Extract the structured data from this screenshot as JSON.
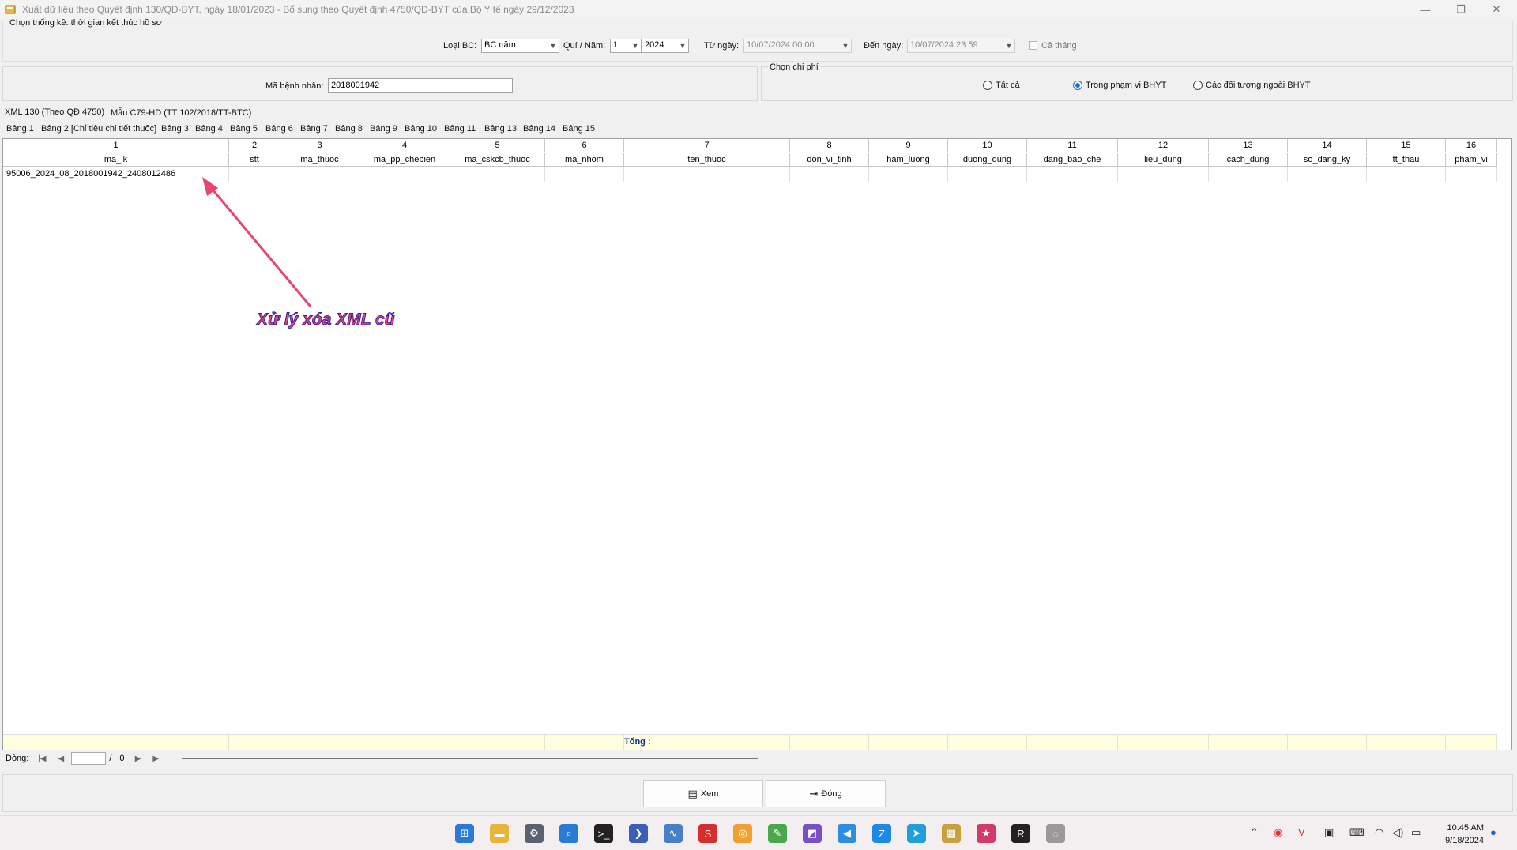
{
  "window": {
    "title": "Xuất dữ liệu theo Quyết định 130/QĐ-BYT, ngày 18/01/2023 - Bổ sung theo Quyết định 4750/QĐ-BYT của Bộ Y tế ngày 29/12/2023",
    "minimize": "—",
    "restore": "❐",
    "close": "✕"
  },
  "filters": {
    "group_label": "Chọn thống kê: thời gian kết thúc hồ sơ",
    "report_type_label": "Loại BC:",
    "report_type_value": "BC năm",
    "quarter_year_label": "Quí / Năm:",
    "quarter_value": "1",
    "year_value": "2024",
    "from_label": "Từ ngày:",
    "from_value": "10/07/2024 00:00",
    "to_label": "Đến ngày:",
    "to_value": "10/07/2024 23:59",
    "whole_month_label": "Cả tháng"
  },
  "patient": {
    "label": "Mã bệnh nhân:",
    "value": "2018001942"
  },
  "cost": {
    "group_label": "Chọn chi phí",
    "options": [
      "Tất cả",
      "Trong phạm vi BHYT",
      "Các đối tượng ngoài BHYT"
    ]
  },
  "main_tabs": [
    "XML 130 (Theo QĐ 4750)",
    "Mẫu C79-HD (TT 102/2018/TT-BTC)"
  ],
  "sub_tabs": [
    "Bảng 1",
    "Bảng 2 [Chỉ tiêu chi tiết thuốc]",
    "Bảng 3",
    "Bảng 4",
    "Bảng 5",
    "Bảng 6",
    "Bảng 7",
    "Bảng 8",
    "Bảng 9",
    "Bảng 10",
    "Bảng 11",
    "Bảng 13",
    "Bảng 14",
    "Bảng 15"
  ],
  "grid": {
    "column_numbers": [
      "1",
      "2",
      "3",
      "4",
      "5",
      "6",
      "7",
      "8",
      "9",
      "10",
      "11",
      "12",
      "13",
      "14",
      "15",
      "16"
    ],
    "column_names": [
      "ma_lk",
      "stt",
      "ma_thuoc",
      "ma_pp_chebien",
      "ma_cskcb_thuoc",
      "ma_nhom",
      "ten_thuoc",
      "don_vi_tinh",
      "ham_luong",
      "duong_dung",
      "dang_bao_che",
      "lieu_dung",
      "cach_dung",
      "so_dang_ky",
      "tt_thau",
      "pham_vi"
    ],
    "rows": [
      [
        "95006_2024_08_2018001942_2408012486",
        "",
        "",
        "",
        "",
        "",
        "",
        "",
        "",
        "",
        "",
        "",
        "",
        "",
        "",
        ""
      ]
    ],
    "total_label": "Tổng :"
  },
  "annotation": {
    "text": "Xử lý xóa XML cũ",
    "color": "#e8466e"
  },
  "navigator": {
    "label": "Dòng:",
    "separator": "/",
    "total": "0",
    "first": "|◀",
    "prev": "◀",
    "next": "▶",
    "last": "▶|"
  },
  "buttons": {
    "view": "Xem",
    "close": "Đóng"
  },
  "taskbar": {
    "time": "10:45 AM",
    "date": "9/18/2024",
    "icons": [
      "windows-start",
      "file-explorer",
      "settings",
      "search-app",
      "terminal",
      "powershell",
      "performance-monitor",
      "sql-app",
      "chrome-canary",
      "notepad",
      "visual-studio",
      "vscode",
      "zalo",
      "telegram",
      "app-archive",
      "app-star",
      "app-dark",
      "app-extra"
    ]
  }
}
